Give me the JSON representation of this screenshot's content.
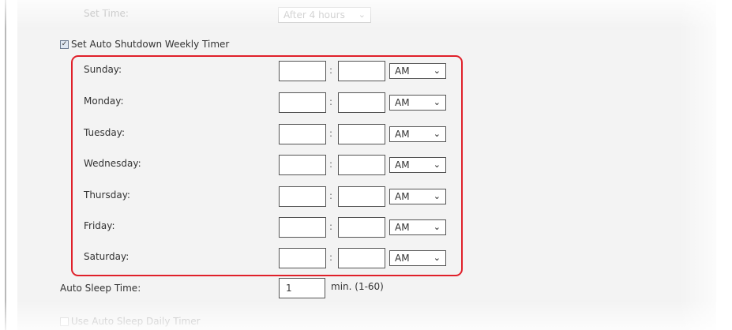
{
  "set_time": {
    "label": "Set Time:",
    "value": "After 4 hours"
  },
  "weekly_timer": {
    "label": "Set Auto Shutdown Weekly Timer",
    "checked": true
  },
  "days": [
    {
      "label": "Sunday:",
      "hour": "",
      "minute": "",
      "ampm": "AM"
    },
    {
      "label": "Monday:",
      "hour": "",
      "minute": "",
      "ampm": "AM"
    },
    {
      "label": "Tuesday:",
      "hour": "",
      "minute": "",
      "ampm": "AM"
    },
    {
      "label": "Wednesday:",
      "hour": "",
      "minute": "",
      "ampm": "AM"
    },
    {
      "label": "Thursday:",
      "hour": "",
      "minute": "",
      "ampm": "AM"
    },
    {
      "label": "Friday:",
      "hour": "",
      "minute": "",
      "ampm": "AM"
    },
    {
      "label": "Saturday:",
      "hour": "",
      "minute": "",
      "ampm": "AM"
    }
  ],
  "colon": ":",
  "chevron": "❯",
  "auto_sleep": {
    "label": "Auto Sleep Time:",
    "value": "1",
    "unit": "min. (1-60)"
  },
  "daily_timer": {
    "label": "Use Auto Sleep Daily Timer",
    "checked": false
  },
  "colors": {
    "highlight": "#e0202a",
    "panel": "#f3f3f3"
  }
}
